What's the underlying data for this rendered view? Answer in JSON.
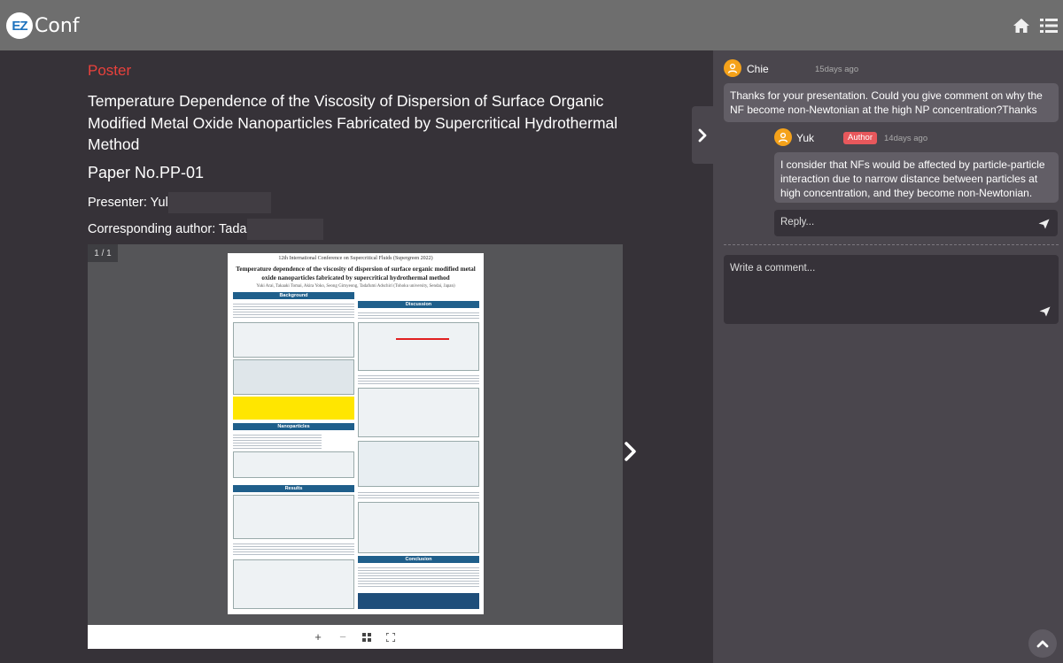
{
  "header": {
    "logo_badge": "EZ",
    "logo_text": "Conf",
    "home_icon": "home-icon",
    "menu_icon": "list-menu-icon"
  },
  "paper": {
    "section_label": "Poster",
    "title": "Temperature Dependence of the Viscosity of Dispersion of Surface Organic Modified Metal Oxide Nanoparticles Fabricated by Supercritical Hydrothermal Method",
    "paper_no": "Paper No.PP-01",
    "presenter": "Presenter: Yul",
    "corresponding": "Corresponding author: Tada"
  },
  "viewer": {
    "page_count": "1 / 1",
    "toolbar": {
      "zoom_in": "+",
      "zoom_out": "−",
      "grid": "grid-icon",
      "fullscreen": "fullscreen-icon"
    },
    "poster": {
      "conference": "12th International Conference on Supercritical Fluids (Supergreen 2022)",
      "title": "Temperature dependence of the viscosity of dispersion of surface organic modified metal oxide nanoparticles fabricated by supercritical hydrothermal method",
      "authors": "Yuki Arai, Takaaki Tomai, Akira Yoko, Seong Gimyeong, Tadafumi Adschiri (Tohoku university, Sendai, Japan)",
      "sections": {
        "background": "Background",
        "discussion": "Discussion",
        "nanoparticles": "Nanoparticles",
        "results": "Results",
        "conclusion": "Conclusion"
      }
    }
  },
  "comments": [
    {
      "name": "Chie",
      "time": "15days ago",
      "text": "Thanks for your presentation. Could you give comment on why the NF become non-Newtonian at the high NP concentration?Thanks"
    }
  ],
  "reply": {
    "name": "Yuk",
    "badge": "Author",
    "time": "14days ago",
    "text": "I consider that NFs would be affected by particle-particle interaction due to narrow distance between particles at high concentration, and they become non-Newtonian."
  },
  "reply_input": {
    "placeholder": "Reply..."
  },
  "comment_input": {
    "placeholder": "Write a comment..."
  },
  "colors": {
    "accent_red": "#e8413c",
    "avatar_orange": "#f5a21a",
    "author_badge": "#e8585c",
    "header_bg": "#6e6e6e"
  }
}
